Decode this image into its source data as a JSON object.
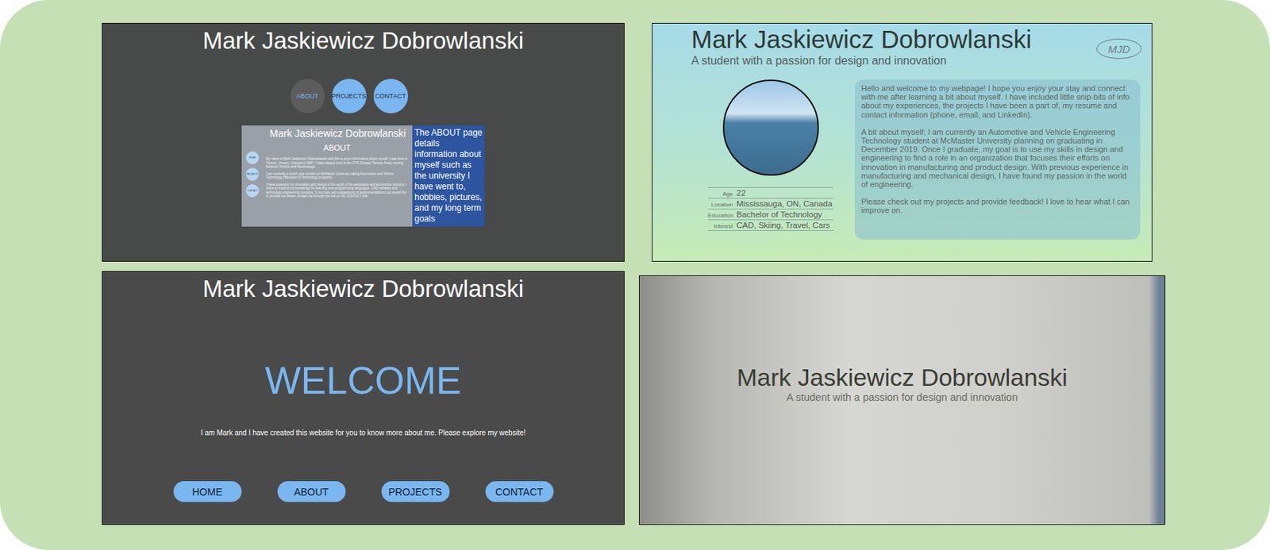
{
  "panels": {
    "about_mockup": {
      "title": "Mark Jaskiewicz Dobrowlanski",
      "nav": [
        {
          "label": "ABOUT",
          "selected": true
        },
        {
          "label": "PROJECTS",
          "selected": false
        },
        {
          "label": "CONTACT",
          "selected": false
        }
      ],
      "preview": {
        "title": "Mark Jaskiewicz Dobrowlanski",
        "heading": "ABOUT",
        "nav": [
          "HOME",
          "PROJECTS",
          "CONTACT"
        ],
        "paragraphs": [
          "My name is Mark Jaskiewicz Dobrowlanski and this is some information about myself. I was born in Toronto, Ontario, Canada in 1997. I have always lived in the GTA (Greater Toronto Area) moving between Toronto and Mississauga.",
          "I am currently a fourth year student at McMaster University taking Automotive and Vehicle Technology (Bachelor of Technology program).",
          "I have a passion for innovation and design in the world of the aerospace and automotive industry. I strive to expand my knowledge by learning new programming languages, CAD software and technology engineering concepts. If you have any suggestions or recommendations you would like to provide me please contact me through the link on my CONTACT link."
        ]
      },
      "note": "The ABOUT page details information about myself such as the university I have went to, hobbies, pictures, and my long term goals"
    },
    "about_page": {
      "title": "Mark Jaskiewicz Dobrowlanski",
      "subtitle": "A student with a passion for design and innovation",
      "logo": "MJD",
      "info": [
        {
          "label": "Age",
          "value": "22"
        },
        {
          "label": "Location",
          "value": "Mississauga, ON, Canada"
        },
        {
          "label": "Education",
          "value": "Bachelor of Technology"
        },
        {
          "label": "Interest",
          "value": "CAD, Skiing, Travel, Cars"
        }
      ],
      "paragraphs": [
        "Hello and welcome to my webpage! I hope you enjoy your stay and connect with me after learning a bit about myself. I have included little snip-bits of info about my experiences, the projects I have been a part of, my resume and contact information (phone, email, and LinkedIn).",
        "A bit about myself; I am currently an Automotive and Vehicle Engineering Technology student at McMaster University planning on graduating in December 2019. Once I graduate, my goal is to use my skills in design and engineering to find a role in an organization that focuses their efforts on innovation in manufacturing and product design. With previous experience in manufacturing and mechanical design, I have found my passion in the world of engineering.",
        "Please check out my projects and provide feedback! I love to hear what I can improve on."
      ]
    },
    "welcome_page": {
      "title": "Mark Jaskiewicz Dobrowlanski",
      "heading": "WELCOME",
      "text": "I am Mark and I have created this website for you to know more about me. Please explore my website!",
      "nav": [
        "HOME",
        "ABOUT",
        "PROJECTS",
        "CONTACT"
      ]
    },
    "landing_page": {
      "title": "Mark Jaskiewicz Dobrowlanski",
      "subtitle": "A student with a passion for design and innovation"
    }
  }
}
